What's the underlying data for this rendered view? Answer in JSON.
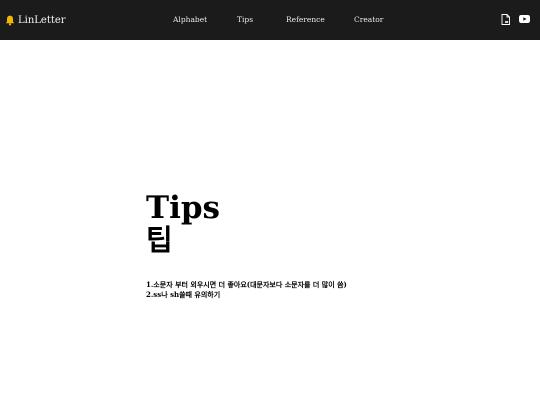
{
  "navbar": {
    "brand_label": "LinLetter",
    "brand_icon": "bell-icon",
    "links": [
      {
        "label": "Alphabet"
      },
      {
        "label": "Tips"
      },
      {
        "label": "Reference"
      },
      {
        "label": "Creator"
      }
    ],
    "actions": [
      {
        "icon": "file-icon"
      },
      {
        "icon": "youtube-icon"
      }
    ],
    "colors": {
      "background": "#1b1b1b",
      "text": "#eaeaea",
      "accent": "#f2b705"
    }
  },
  "main": {
    "title_en": "Tips",
    "title_ko": "팁",
    "tips": [
      "1.소문자 부터 외우시면 더 좋아요(대문자보다 소문자를 더 많이 씀)",
      "2.ss나 sh쓸때 유의하기"
    ]
  }
}
